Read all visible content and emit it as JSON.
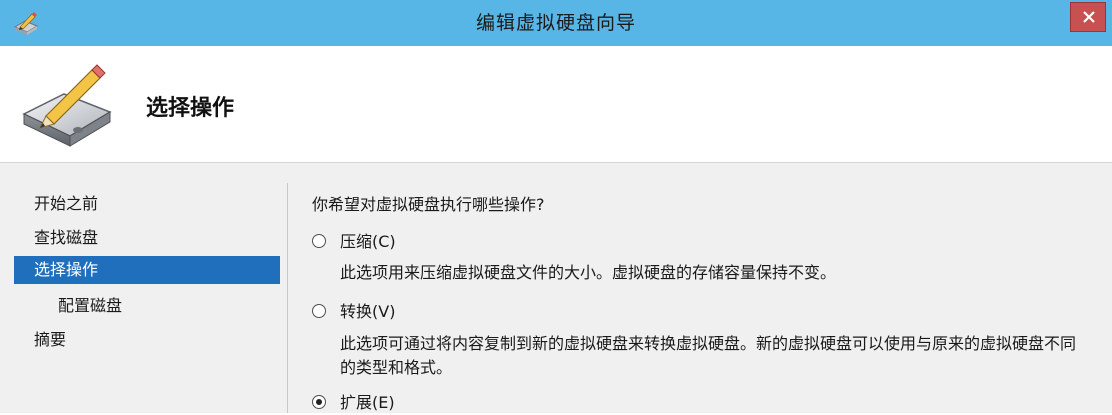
{
  "window": {
    "title": "编辑虚拟硬盘向导"
  },
  "header": {
    "title": "选择操作"
  },
  "nav": {
    "items": [
      {
        "label": "开始之前"
      },
      {
        "label": "查找磁盘"
      },
      {
        "label": "选择操作"
      },
      {
        "label": "配置磁盘"
      },
      {
        "label": "摘要"
      }
    ],
    "selected": "选择操作"
  },
  "main": {
    "question": "你希望对虚拟硬盘执行哪些操作?",
    "options": [
      {
        "label": "压缩(C)",
        "description": "此选项用来压缩虚拟硬盘文件的大小。虚拟硬盘的存储容量保持不变。",
        "checked": false
      },
      {
        "label": "转换(V)",
        "description": "此选项可通过将内容复制到新的虚拟硬盘来转换虚拟硬盘。新的虚拟硬盘可以使用与原来的虚拟硬盘不同的类型和格式。",
        "checked": false
      },
      {
        "label": "扩展(E)",
        "checked": true
      }
    ]
  },
  "colors": {
    "titlebar": "#58b6e6",
    "selection": "#1f6fbd",
    "close_button": "#c75050",
    "content_bg": "#f0f0f0"
  },
  "icons": {
    "app": "pencil-disk-icon",
    "header": "hard-disk-pencil-icon",
    "close": "close-icon"
  }
}
